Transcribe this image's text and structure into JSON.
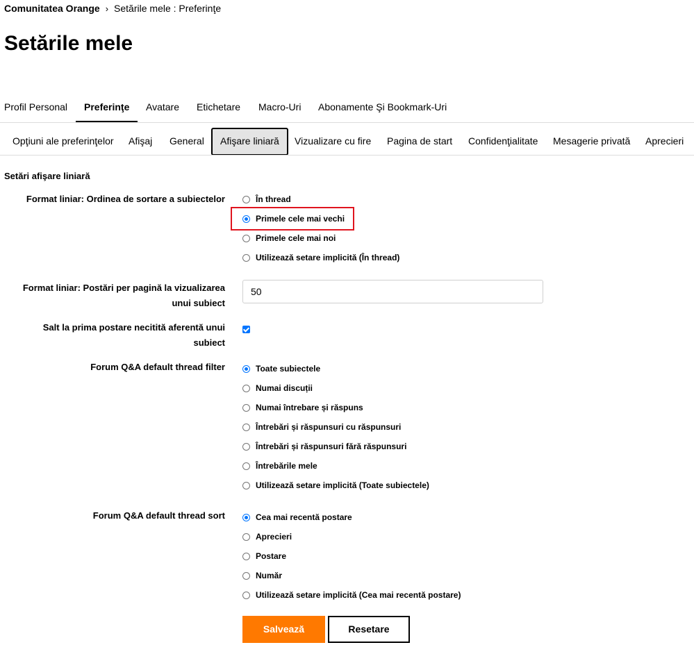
{
  "breadcrumb": {
    "root": "Comunitatea Orange",
    "separator": "›",
    "current": "Setările mele : Preferinţe"
  },
  "page_title": "Setările mele",
  "primary_tabs": [
    {
      "label": "Profil Personal"
    },
    {
      "label": "Preferinţe"
    },
    {
      "label": "Avatare"
    },
    {
      "label": "Etichetare"
    },
    {
      "label": "Macro-Uri"
    },
    {
      "label": "Abonamente Şi Bookmark-Uri"
    }
  ],
  "secondary_tabs": [
    {
      "label": "Opţiuni ale preferinţelor"
    },
    {
      "label": "Afişaj"
    },
    {
      "label": "General"
    },
    {
      "label": "Afişare liniară"
    },
    {
      "label": "Vizualizare cu fire"
    },
    {
      "label": "Pagina de start"
    },
    {
      "label": "Confidenţialitate"
    },
    {
      "label": "Mesagerie privată"
    },
    {
      "label": "Aprecieri"
    }
  ],
  "section_title": "Setări afişare liniară",
  "sort_order": {
    "label": "Format liniar: Ordinea de sortare a subiectelor",
    "options": [
      {
        "label": "În thread",
        "checked": false
      },
      {
        "label": "Primele cele mai vechi",
        "checked": true
      },
      {
        "label": "Primele cele mai noi",
        "checked": false
      },
      {
        "label": "Utilizează setare implicită (În thread)",
        "checked": false
      }
    ]
  },
  "posts_per_page": {
    "label_line1": "Format liniar: Postări per pagină la vizualizarea",
    "label_line2": "unui subiect",
    "value": "50"
  },
  "jump_unread": {
    "label_line1": "Salt la prima postare necitită aferentă unui",
    "label_line2": "subiect",
    "checked": true
  },
  "qa_filter": {
    "label": "Forum Q&A default thread filter",
    "options": [
      {
        "label": "Toate subiectele",
        "checked": true
      },
      {
        "label": "Numai discuții",
        "checked": false
      },
      {
        "label": "Numai întrebare și răspuns",
        "checked": false
      },
      {
        "label": "Întrebări și răspunsuri cu răspunsuri",
        "checked": false
      },
      {
        "label": "Întrebări și răspunsuri fără răspunsuri",
        "checked": false
      },
      {
        "label": "Întrebările mele",
        "checked": false
      },
      {
        "label": "Utilizează setare implicită (Toate subiectele)",
        "checked": false
      }
    ]
  },
  "qa_sort": {
    "label": "Forum Q&A default thread sort",
    "options": [
      {
        "label": "Cea mai recentă postare",
        "checked": true
      },
      {
        "label": "Aprecieri",
        "checked": false
      },
      {
        "label": "Postare",
        "checked": false
      },
      {
        "label": "Număr",
        "checked": false
      },
      {
        "label": "Utilizează setare implicită (Cea mai recentă postare)",
        "checked": false
      }
    ]
  },
  "buttons": {
    "save": "Salvează",
    "reset": "Resetare"
  },
  "colors": {
    "accent": "#ff7900",
    "radio_checked": "#0075ff",
    "highlight": "#e0141e"
  }
}
